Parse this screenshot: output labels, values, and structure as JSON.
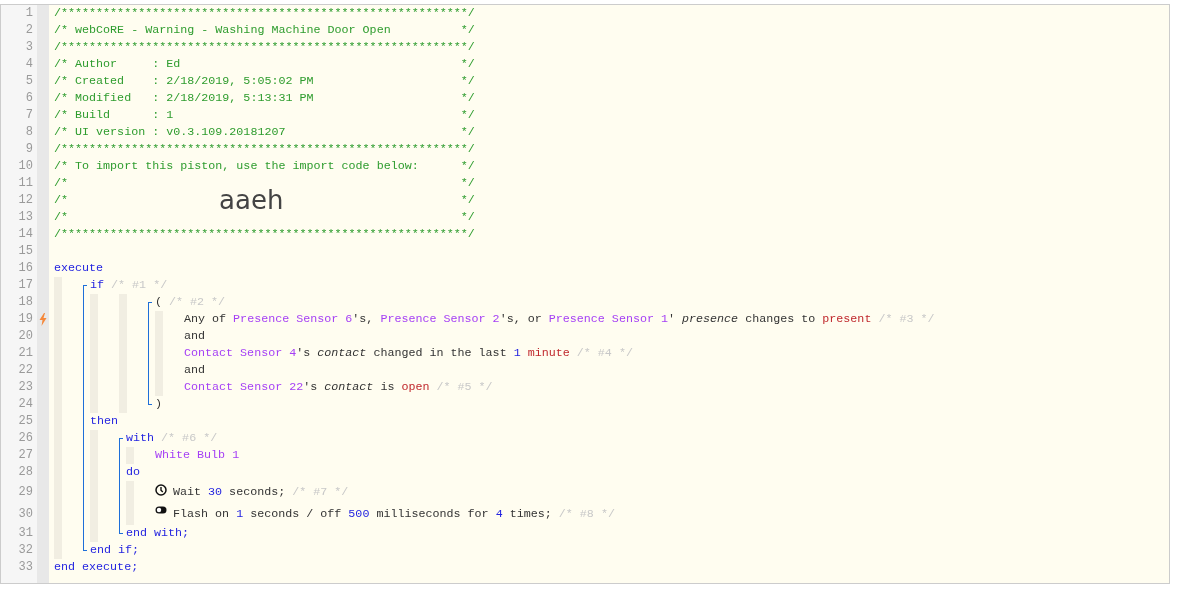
{
  "editor": {
    "code": [
      {
        "kind": "line",
        "number": "1",
        "trigger": false,
        "tokens": [
          {
            "kind": "comment",
            "text": "/**********************************************************/"
          }
        ]
      },
      {
        "kind": "line",
        "number": "2",
        "trigger": false,
        "tokens": [
          {
            "kind": "comment",
            "text": "/* webCoRE - Warning - Washing Machine Door Open          */"
          }
        ]
      },
      {
        "kind": "line",
        "number": "3",
        "trigger": false,
        "tokens": [
          {
            "kind": "comment",
            "text": "/**********************************************************/"
          }
        ]
      },
      {
        "kind": "line",
        "number": "4",
        "trigger": false,
        "tokens": [
          {
            "kind": "comment",
            "text": "/* Author     : Ed                                        */"
          }
        ]
      },
      {
        "kind": "line",
        "number": "5",
        "trigger": false,
        "tokens": [
          {
            "kind": "comment",
            "text": "/* Created    : 2/18/2019, 5:05:02 PM                     */"
          }
        ]
      },
      {
        "kind": "line",
        "number": "6",
        "trigger": false,
        "tokens": [
          {
            "kind": "comment",
            "text": "/* Modified   : 2/18/2019, 5:13:31 PM                     */"
          }
        ]
      },
      {
        "kind": "line",
        "number": "7",
        "trigger": false,
        "tokens": [
          {
            "kind": "comment",
            "text": "/* Build      : 1                                         */"
          }
        ]
      },
      {
        "kind": "line",
        "number": "8",
        "trigger": false,
        "tokens": [
          {
            "kind": "comment",
            "text": "/* UI version : v0.3.109.20181207                         */"
          }
        ]
      },
      {
        "kind": "line",
        "number": "9",
        "trigger": false,
        "tokens": [
          {
            "kind": "comment",
            "text": "/**********************************************************/"
          }
        ]
      },
      {
        "kind": "line",
        "number": "10",
        "trigger": false,
        "tokens": [
          {
            "kind": "comment",
            "text": "/* To import this piston, use the import code below:      */"
          }
        ]
      },
      {
        "kind": "line",
        "number": "11",
        "trigger": false,
        "tokens": [
          {
            "kind": "comment",
            "text": "/*                                                        */"
          }
        ]
      },
      {
        "kind": "import",
        "number": "12",
        "trigger": false,
        "tokens": [
          {
            "kind": "comment",
            "text": "/*"
          },
          {
            "kind": "code",
            "text": "aaeh"
          },
          {
            "kind": "comment",
            "text": "*/"
          }
        ]
      },
      {
        "kind": "line",
        "number": "13",
        "trigger": false,
        "tokens": [
          {
            "kind": "comment",
            "text": "/*                                                        */"
          }
        ]
      },
      {
        "kind": "line",
        "number": "14",
        "trigger": false,
        "tokens": [
          {
            "kind": "comment",
            "text": "/**********************************************************/"
          }
        ]
      },
      {
        "kind": "line",
        "number": "15",
        "trigger": false
      },
      {
        "kind": "block",
        "bracket": false,
        "parts": [
          {
            "kind": "line",
            "number": "16",
            "trigger": false,
            "tokens": [
              {
                "kind": "keyword",
                "text": "execute"
              }
            ]
          },
          {
            "kind": "body",
            "children": [
              {
                "kind": "block",
                "bracket": true,
                "parts": [
                  {
                    "kind": "line",
                    "number": "17",
                    "trigger": false,
                    "tokens": [
                      {
                        "kind": "keyword",
                        "text": "if"
                      },
                      {
                        "kind": "note",
                        "text": " /* #1 */"
                      }
                    ]
                  },
                  {
                    "kind": "body",
                    "children": [
                      {
                        "kind": "body",
                        "children": [
                          {
                            "kind": "block",
                            "bracket": true,
                            "parts": [
                              {
                                "kind": "line",
                                "number": "18",
                                "trigger": false,
                                "tokens": [
                                  {
                                    "kind": "text",
                                    "text": "("
                                  },
                                  {
                                    "kind": "note",
                                    "text": " /* #2 */"
                                  }
                                ]
                              },
                              {
                                "kind": "body",
                                "children": [
                                  {
                                    "kind": "line",
                                    "number": "19",
                                    "trigger": true,
                                    "tokens": [
                                      {
                                        "kind": "text",
                                        "text": "Any of "
                                      },
                                      {
                                        "kind": "device",
                                        "text": "Presence Sensor 6"
                                      },
                                      {
                                        "kind": "text",
                                        "text": "'s, "
                                      },
                                      {
                                        "kind": "device",
                                        "text": "Presence Sensor 2"
                                      },
                                      {
                                        "kind": "text",
                                        "text": "'s, or "
                                      },
                                      {
                                        "kind": "device",
                                        "text": "Presence Sensor 1"
                                      },
                                      {
                                        "kind": "text",
                                        "text": "' "
                                      },
                                      {
                                        "kind": "italic",
                                        "text": "presence"
                                      },
                                      {
                                        "kind": "text",
                                        "text": " changes to "
                                      },
                                      {
                                        "kind": "value",
                                        "text": "present"
                                      },
                                      {
                                        "kind": "note",
                                        "text": " /* #3 */"
                                      }
                                    ]
                                  },
                                  {
                                    "kind": "line",
                                    "number": "20",
                                    "trigger": false,
                                    "tokens": [
                                      {
                                        "kind": "text",
                                        "text": "and"
                                      }
                                    ]
                                  },
                                  {
                                    "kind": "line",
                                    "number": "21",
                                    "trigger": false,
                                    "tokens": [
                                      {
                                        "kind": "device",
                                        "text": "Contact Sensor 4"
                                      },
                                      {
                                        "kind": "text",
                                        "text": "'s "
                                      },
                                      {
                                        "kind": "italic",
                                        "text": "contact"
                                      },
                                      {
                                        "kind": "text",
                                        "text": " changed in the last "
                                      },
                                      {
                                        "kind": "number",
                                        "text": "1"
                                      },
                                      {
                                        "kind": "value",
                                        "text": " minute"
                                      },
                                      {
                                        "kind": "note",
                                        "text": " /* #4 */"
                                      }
                                    ]
                                  },
                                  {
                                    "kind": "line",
                                    "number": "22",
                                    "trigger": false,
                                    "tokens": [
                                      {
                                        "kind": "text",
                                        "text": "and"
                                      }
                                    ]
                                  },
                                  {
                                    "kind": "line",
                                    "number": "23",
                                    "trigger": false,
                                    "tokens": [
                                      {
                                        "kind": "device",
                                        "text": "Contact Sensor 22"
                                      },
                                      {
                                        "kind": "text",
                                        "text": "'s "
                                      },
                                      {
                                        "kind": "italic",
                                        "text": "contact"
                                      },
                                      {
                                        "kind": "text",
                                        "text": " is "
                                      },
                                      {
                                        "kind": "value",
                                        "text": "open"
                                      },
                                      {
                                        "kind": "note",
                                        "text": " /* #5 */"
                                      }
                                    ]
                                  }
                                ]
                              },
                              {
                                "kind": "line",
                                "number": "24",
                                "trigger": false,
                                "tokens": [
                                  {
                                    "kind": "text",
                                    "text": ")"
                                  }
                                ]
                              }
                            ]
                          }
                        ]
                      }
                    ]
                  },
                  {
                    "kind": "line",
                    "number": "25",
                    "trigger": false,
                    "tokens": [
                      {
                        "kind": "keyword",
                        "text": "then"
                      }
                    ]
                  },
                  {
                    "kind": "body",
                    "children": [
                      {
                        "kind": "block",
                        "bracket": true,
                        "parts": [
                          {
                            "kind": "line",
                            "number": "26",
                            "trigger": false,
                            "tokens": [
                              {
                                "kind": "keyword",
                                "text": "with"
                              },
                              {
                                "kind": "note",
                                "text": " /* #6 */"
                              }
                            ]
                          },
                          {
                            "kind": "body",
                            "children": [
                              {
                                "kind": "line",
                                "number": "27",
                                "trigger": false,
                                "tokens": [
                                  {
                                    "kind": "device",
                                    "text": "White Bulb 1"
                                  }
                                ]
                              }
                            ]
                          },
                          {
                            "kind": "line",
                            "number": "28",
                            "trigger": false,
                            "tokens": [
                              {
                                "kind": "keyword",
                                "text": "do"
                              }
                            ]
                          },
                          {
                            "kind": "body",
                            "children": [
                              {
                                "kind": "wait",
                                "number": "29",
                                "trigger": false,
                                "tokens": [
                                  {
                                    "kind": "text",
                                    "text": "Wait "
                                  },
                                  {
                                    "kind": "number",
                                    "text": "30"
                                  },
                                  {
                                    "kind": "text",
                                    "text": " seconds;"
                                  },
                                  {
                                    "kind": "note",
                                    "text": " /* #7 */"
                                  }
                                ]
                              },
                              {
                                "kind": "command",
                                "number": "30",
                                "trigger": false,
                                "tokens": [
                                  {
                                    "kind": "text",
                                    "text": "Flash on "
                                  },
                                  {
                                    "kind": "number",
                                    "text": "1"
                                  },
                                  {
                                    "kind": "text",
                                    "text": " seconds / off "
                                  },
                                  {
                                    "kind": "number",
                                    "text": "500"
                                  },
                                  {
                                    "kind": "text",
                                    "text": " milliseconds for "
                                  },
                                  {
                                    "kind": "number",
                                    "text": "4"
                                  },
                                  {
                                    "kind": "text",
                                    "text": " times;"
                                  },
                                  {
                                    "kind": "note",
                                    "text": " /* #8 */"
                                  }
                                ]
                              }
                            ]
                          },
                          {
                            "kind": "line",
                            "number": "31",
                            "trigger": false,
                            "tokens": [
                              {
                                "kind": "keyword",
                                "text": "end with;"
                              }
                            ]
                          }
                        ]
                      }
                    ]
                  },
                  {
                    "kind": "line",
                    "number": "32",
                    "trigger": false,
                    "tokens": [
                      {
                        "kind": "keyword",
                        "text": "end if;"
                      }
                    ]
                  }
                ]
              }
            ]
          },
          {
            "kind": "line",
            "number": "33",
            "trigger": false,
            "tokens": [
              {
                "kind": "keyword",
                "text": "end execute;"
              }
            ]
          }
        ]
      }
    ]
  }
}
